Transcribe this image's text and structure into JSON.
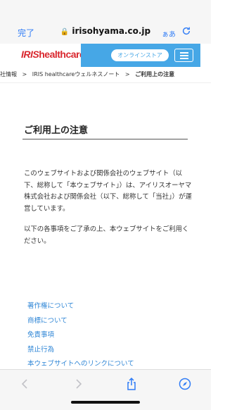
{
  "browser": {
    "done_label": "完了",
    "url": "irisohyama.co.jp",
    "text_size_label": "ぁあ"
  },
  "header": {
    "logo_prefix": "IRIS",
    "logo_suffix": "healthcare",
    "store_button": "オンラインストア"
  },
  "breadcrumb": [
    "会社情報",
    "IRIS healthcareウェルネスノート",
    "ご利用上の注意"
  ],
  "page": {
    "title": "ご利用上の注意",
    "paragraph1": "このウェブサイトおよび関係会社のウェブサイト（以下、総称して「本ウェブサイト」）は、アイリスオーヤマ株式会社および関係会社（以下、総称して「当社」）が運営しています。",
    "paragraph2": "以下の各事項をご了承の上、本ウェブサイトをご利用ください。"
  },
  "links": [
    "著作権について",
    "商標について",
    "免責事項",
    "禁止行為",
    "本ウェブサイトへのリンクについて"
  ],
  "colors": {
    "brand_red": "#d9282f",
    "header_blue": "#46a7e6",
    "link_blue": "#2f86d6",
    "ios_blue": "#2f7cf6"
  }
}
